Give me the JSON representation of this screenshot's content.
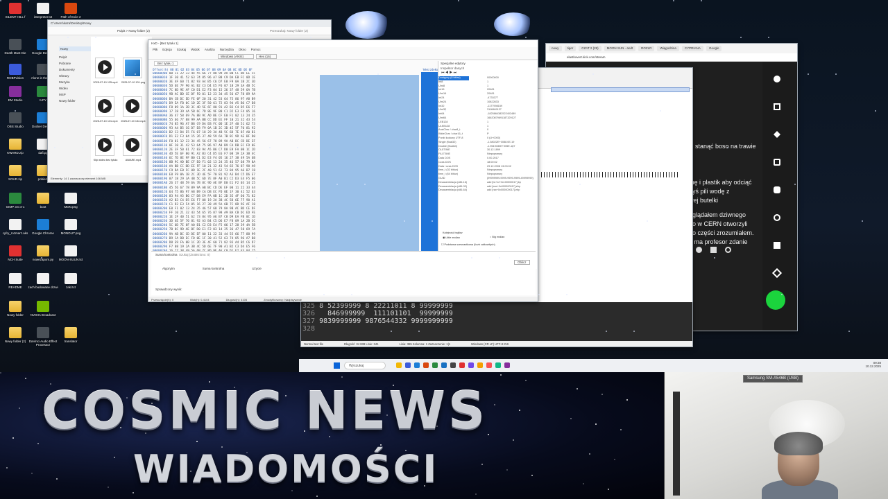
{
  "desktop_icons": [
    {
      "label": "SILENT HILL f"
    },
    {
      "label": "interpreter.txt"
    },
    {
      "label": "Path of Exile 2"
    },
    {
      "label": "Death Must Die"
    },
    {
      "label": "Google Desktop"
    },
    {
      "label": "ROBPvision"
    },
    {
      "label": "Alone in the Dark"
    },
    {
      "label": "EM Studio"
    },
    {
      "label": "ILPY"
    },
    {
      "label": "OBS Studio"
    },
    {
      "label": "Docker Desktop"
    },
    {
      "label": "KWARD.zip"
    },
    {
      "label": "dafi.py"
    },
    {
      "label": "SOHR.zip"
    },
    {
      "label": "pobierz"
    },
    {
      "label": "GIMP 3.0.4-1"
    },
    {
      "label": "boot"
    },
    {
      "label": "MON.png"
    },
    {
      "label": "cyfry_rozmarz.aks"
    },
    {
      "label": "Google Chrome"
    },
    {
      "label": "MONOLIT.png"
    },
    {
      "label": "NCH Suite"
    },
    {
      "label": "nowezapom.py"
    },
    {
      "label": "MOON-SUUN.txt"
    },
    {
      "label": "README"
    },
    {
      "label": "zach budowane drzwi"
    },
    {
      "label": "zakl.txt"
    },
    {
      "label": "Nowy folder"
    },
    {
      "label": "NVIDIA Broadcast"
    },
    {
      "label": "Nowy folder (2)"
    },
    {
      "label": "DaVinci Audio Effect Processor"
    },
    {
      "label": "translator"
    }
  ],
  "explorer": {
    "path": "C:\\Users\\kaza\\Desktop\\Nowy",
    "breadcrumb": "Pulpit  >  Nowy folder (2)",
    "search_placeholder": "Przeszukaj: Nowy folder (2)",
    "new_button": "Nowy",
    "sidebar": [
      "Pulpit",
      "Pobrane",
      "Dokumenty",
      "Obrazy",
      "Muzyka",
      "Wideo",
      "MSP",
      "Nowy folder"
    ],
    "files": [
      {
        "name": "2025-07-10 125.mp4",
        "type": "video"
      },
      {
        "name": "2025-07-10 131.png",
        "type": "image"
      },
      {
        "name": "2025-07-10 131.mp4",
        "type": "video"
      },
      {
        "name": "2025-07-10 134.mp4",
        "type": "video"
      },
      {
        "name": "Klip wideo bez tytułu",
        "type": "video"
      },
      {
        "name": "ANIARE.mp4",
        "type": "video"
      }
    ],
    "status": "Elementy: 14     1 zaznaczony element  106 MB"
  },
  "hex_editor": {
    "title": "HxD - [Bez tytułu 1]",
    "menu": [
      "Plik",
      "Edycja",
      "Szukaj",
      "Widok",
      "Analiza",
      "Narzędzia",
      "Okno",
      "Pomoc"
    ],
    "tab": "Bez tytułu 1",
    "encoding": "Windows (ANSI)",
    "base": "Hex (16)",
    "column_header": "Offset(h) 00 01 02 03 04 05 06 07 08 09 0A 0B 0C 0D 0E 0F",
    "text_header": "Tekst zdekodowany",
    "offsets": [
      "00000000",
      "00000010",
      "00000020",
      "00000030",
      "00000040",
      "00000050",
      "00000060",
      "00000070",
      "00000080",
      "00000090",
      "000000A0",
      "000000B0",
      "000000C0",
      "000000D0",
      "000000E0",
      "000000F0",
      "00000100",
      "00000110",
      "00000120",
      "00000130",
      "00000140",
      "00000150",
      "00000160",
      "00000170",
      "00000180",
      "00000190",
      "000001A0",
      "000001B0",
      "000001C0",
      "000001D0",
      "000001E0",
      "000001F0",
      "00000200",
      "00000210",
      "00000220",
      "00000230",
      "00000240",
      "00000250",
      "00000260",
      "00000270",
      "00000280",
      "00000290",
      "000002A0",
      "000002B0",
      "000002C0",
      "000002D0",
      "000002E0",
      "000002F0",
      "00000300",
      "00000310"
    ],
    "search_tab": "Suma kontrolna",
    "search_tab2": "Szukaj (Znaleziono: 0)",
    "search_cols": [
      "Algorytm",
      "Suma kontrolna",
      "Użycie"
    ],
    "ok": "Oblicz",
    "results_label": "Sprawdzony wynik:",
    "status": [
      "Przesunięcie(h): 0",
      "Blok(h): 0-4104",
      "Długość(h): 4105",
      "Zmodyfikowany: Nadpisywanie"
    ],
    "inspector_title": "Inspektor danych",
    "inspector_tab": "Specjalne edytory",
    "inspector": [
      {
        "type": "Dostępny (8 bitów)",
        "value": "00000000"
      },
      {
        "type": "Int8",
        "value": "1"
      },
      {
        "type": "UInt8",
        "value": "1"
      },
      {
        "type": "Int16",
        "value": "20481"
      },
      {
        "type": "UInt16",
        "value": "20481"
      },
      {
        "type": "Int24",
        "value": "-4733377"
      },
      {
        "type": "UInt24",
        "value": "10822833"
      },
      {
        "type": "Int32",
        "value": "-1177998159"
      },
      {
        "type": "UInt32",
        "value": "3116969137"
      },
      {
        "type": "Int64",
        "value": "-1825864382522402489"
      },
      {
        "type": "UInt64",
        "value": "16620879691187329127"
      },
      {
        "type": "LEB128",
        "value": "1"
      },
      {
        "type": "ULEB128",
        "value": "1"
      },
      {
        "type": "AnsiChar / char8_t",
        "value": "0"
      },
      {
        "type": "WideChar / char16_t",
        "value": "P"
      },
      {
        "type": "Punkt kodowy UTF-8",
        "value": "0 (U+0000)"
      },
      {
        "type": "Single (float32)",
        "value": "-1.58022E+0088.0E-19"
      },
      {
        "type": "Double (float64)",
        "value": "-1.9619330E+005E-187"
      },
      {
        "type": "OLETIME",
        "value": "30.12.1899"
      },
      {
        "type": "FILETIME",
        "value": "Niepoprawny"
      },
      {
        "type": "Data DOS",
        "value": "0.00.2017"
      },
      {
        "type": "Czas DOS",
        "value": "18:00:02"
      },
      {
        "type": "Data i czas DOS",
        "value": "29.12.2008 13:00:02"
      },
      {
        "type": "time_t (32 bitów)",
        "value": "Niepoprawny"
      },
      {
        "type": "time_t (64 bitów)",
        "value": "Niepoprawny"
      },
      {
        "type": "GUID",
        "value": "{99999999-9999-9999-9999-49999999}"
      },
      {
        "type": "Dezasemblacja (x86-16)",
        "value": "add [bx+si+0x100000017],bp"
      },
      {
        "type": "Dezasemblacja (x86-32)",
        "value": "add [eax+0x000000017],ebp"
      },
      {
        "type": "Dezasemblacja (x86-64)",
        "value": "add [rax+0x000000017],ebp"
      }
    ],
    "byte_order": "Kolejność bajtów",
    "little": "Little endian",
    "big": "Big endian",
    "hex_check": "Podstawa szesnastkowa (liczb całkowitych)"
  },
  "notepad": {
    "lines": [
      {
        "n": "325",
        "text": "8 52399999 8 22211011 8 99999999"
      },
      {
        "n": "326",
        "text": "  846999999  111101101  99999999"
      },
      {
        "n": "327",
        "text": "9839999999 9876544332 9999999999"
      },
      {
        "n": "328",
        "text": ""
      }
    ],
    "status": [
      "Normal text file",
      "Długość: 34 838   Linie: 341",
      "Linia: 365   Kolumna: 1   Zaznaczenie: 1|1",
      "Windows (CR LF)   UTF-8   INS"
    ]
  },
  "browser": {
    "tabs": [
      "nowy",
      "tiger",
      "CZAT 2 (28)",
      "MOON SUN - andt",
      "ROZLR",
      "Wiągodzina",
      "CYPRIANA",
      "Google"
    ],
    "url": "elastkovert.kick.com/stream",
    "polish_text": [
      "stanąć boso na trawie",
      "mę i plastik aby odciąć",
      "dyś pili wodę z",
      "wej butelki",
      "oglądałem dziwnego",
      "bo w CERN otworzyli",
      "bo części zrozumiałem.",
      "e ma profesor zdanie"
    ]
  },
  "taskbar": {
    "search": "Wyszukaj",
    "time": "09:38",
    "date": "10.12.2025"
  },
  "brand": {
    "line1": "COSMIC NEWS",
    "line2": "WIADOMOŚCI"
  },
  "camera": {
    "label": "Samsung SM-A546B (USB)"
  }
}
